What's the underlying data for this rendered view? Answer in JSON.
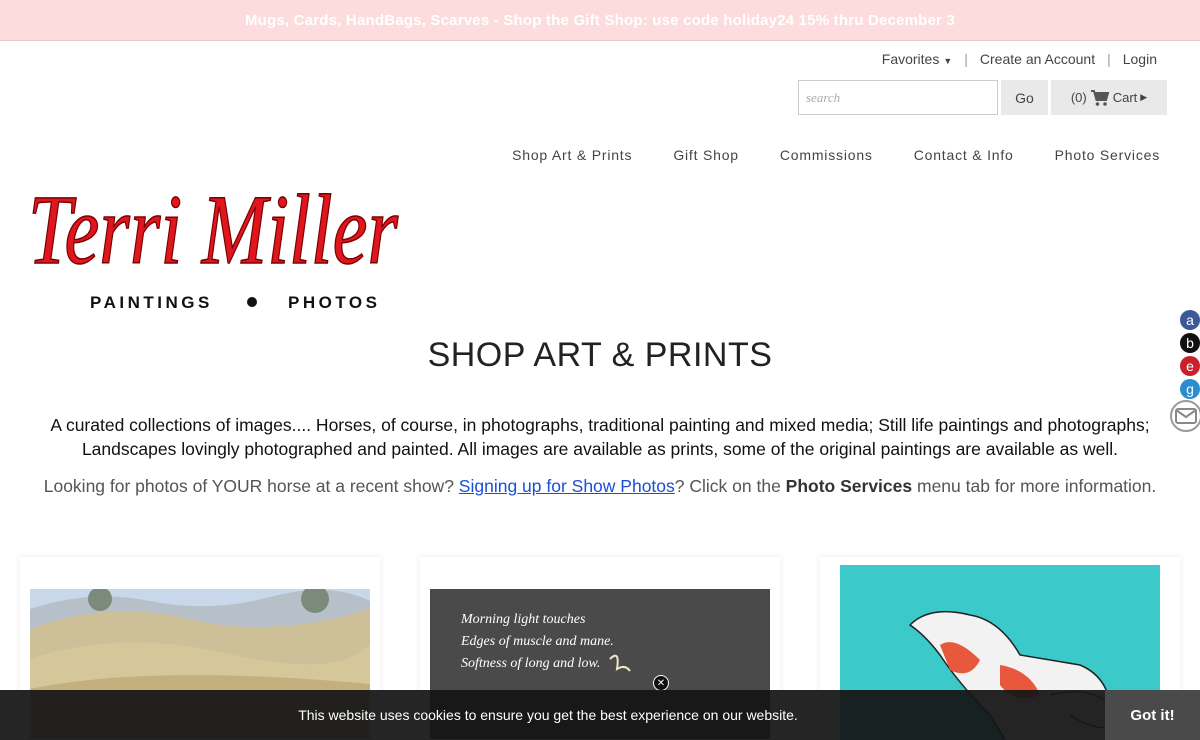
{
  "banner": {
    "text": "Mugs, Cards, HandBags, Scarves - Shop the Gift Shop: use code holiday24 15% thru December 3"
  },
  "toplinks": {
    "favorites": "Favorites",
    "create_account": "Create an Account",
    "login": "Login"
  },
  "search": {
    "placeholder": "search",
    "go_label": "Go"
  },
  "cart": {
    "count": "(0)",
    "label": "Cart"
  },
  "nav": [
    "Shop Art & Prints",
    "Gift Shop",
    "Commissions",
    "Contact & Info",
    "Photo Services"
  ],
  "logo": {
    "name": "Terri Miller",
    "tagline_left": "PAINTINGS",
    "tagline_right": "PHOTOS"
  },
  "page": {
    "title": "SHOP ART & PRINTS",
    "intro": "A curated collections of images.... Horses, of course, in photographs, traditional painting and mixed media; Still life paintings and photographs; Landscapes lovingly photographed and painted. All images are available as prints, some of the original paintings are available as well.",
    "looking_pre": "Looking for photos of YOUR horse at a recent show? ",
    "looking_link": "Signing up for Show Photos",
    "looking_mid": "? Click on the ",
    "looking_bold": "Photo Services",
    "looking_post": " menu tab for more information."
  },
  "poem": [
    "Morning light touches",
    "Edges of muscle and mane.",
    "Softness of long and low."
  ],
  "social": [
    "a",
    "b",
    "e",
    "g"
  ],
  "colors": {
    "banner": "#fcdcdc",
    "logo_red": "#e0161e",
    "link": "#1a4fd6",
    "teal": "#3cc9c9"
  },
  "cookie": {
    "text": "This website uses cookies to ensure you get the best experience on our website.",
    "button": "Got it!"
  }
}
